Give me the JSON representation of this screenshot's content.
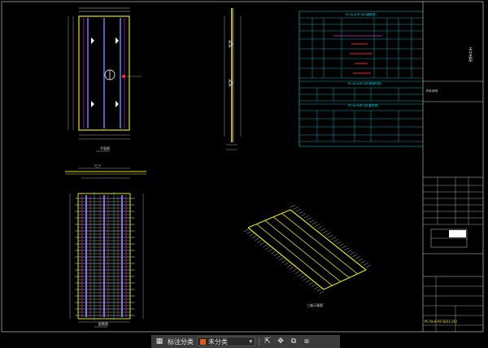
{
  "drawing": {
    "table_title": "PC-Ya-8-RF-BZ(钢筋表)",
    "table_subtitle_1": "PC-Ya-8-RF-BZ(预埋件表)",
    "table_subtitle_2": "PC-Ya-8-RF-BZ(配件表)",
    "label_plan": "平面图",
    "label_rebar": "配筋图",
    "label_iso": "三维示意图",
    "title_block_name": "PC-Ya-8-RF-BZ(1:20)",
    "title_block_note": "构件说明",
    "right_col_text": "未分类配"
  },
  "toolbar": {
    "annotate_label": "标注分类",
    "category_value": "未分类",
    "icons": [
      "grid-icon",
      "chevron-down-icon",
      "export-icon",
      "move-icon",
      "copy-icon",
      "layers-icon"
    ]
  },
  "colors": {
    "background": "#000000",
    "cad_yellow": "#e6e600",
    "cad_cyan": "#00d5e6",
    "cad_magenta": "#cc33cc",
    "cad_white": "#dddddd",
    "cad_blue": "#6f7bff",
    "cad_red": "#ff2020",
    "cad_green": "#33cc33",
    "accent_orange": "#e05a1a"
  }
}
